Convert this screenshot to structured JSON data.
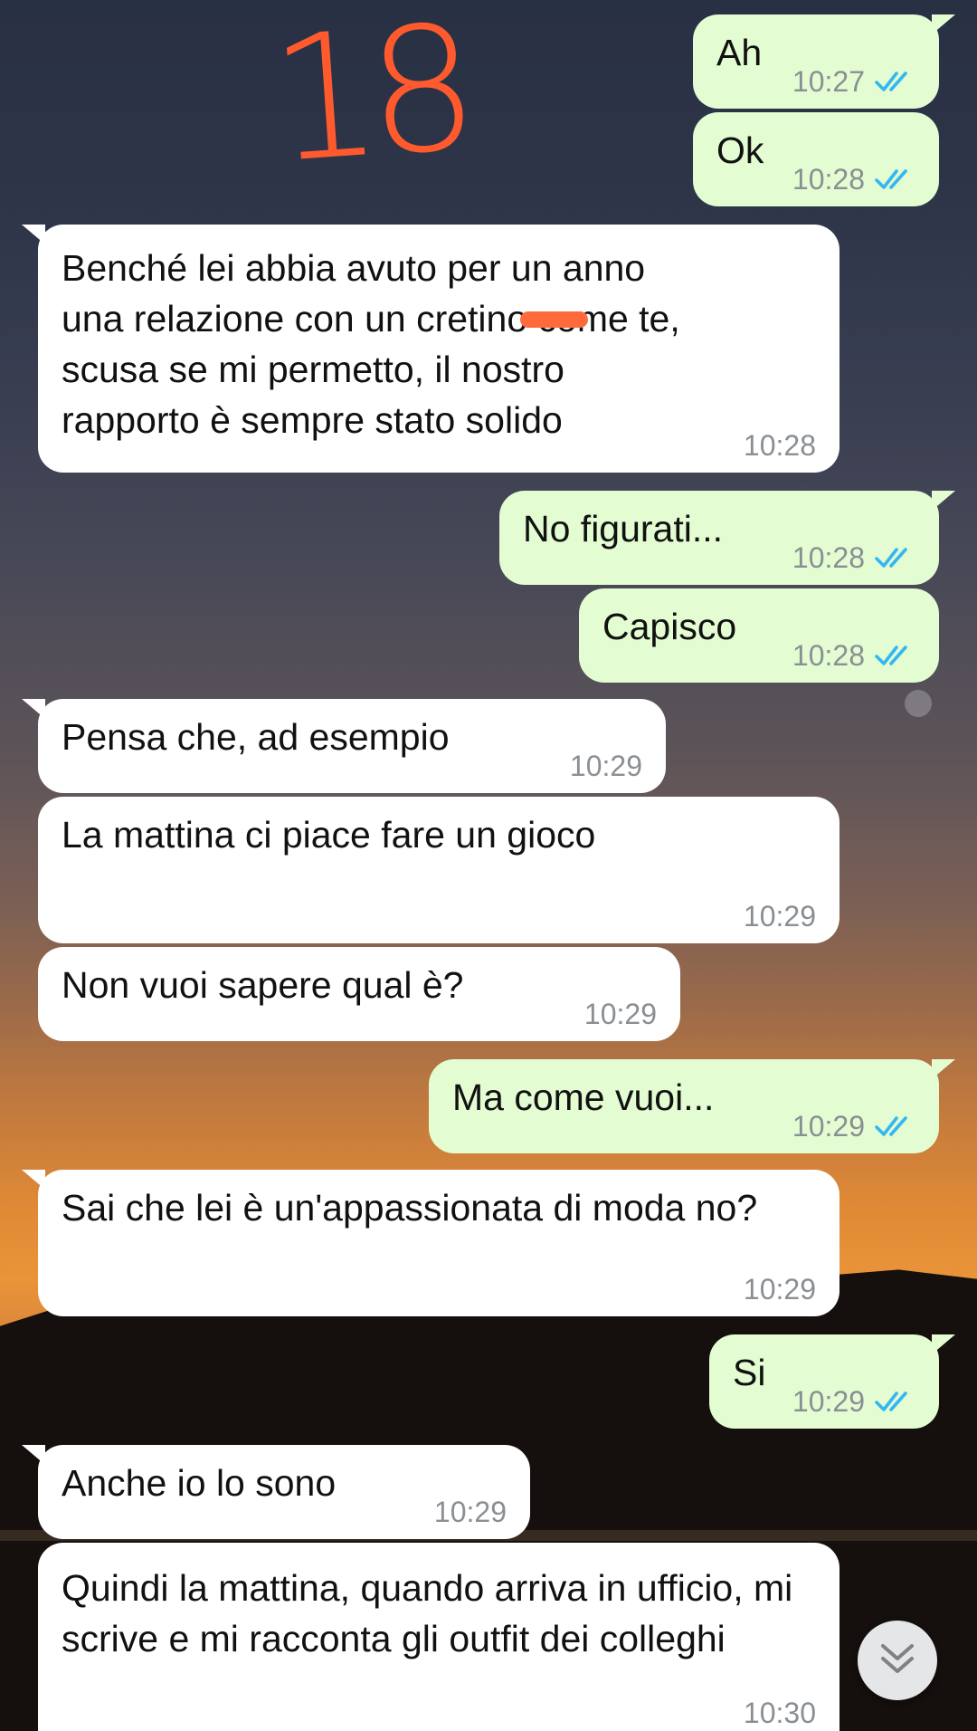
{
  "watermark": "18",
  "messages": [
    {
      "dir": "out",
      "text": "Ah",
      "time": "10:27",
      "read": true
    },
    {
      "dir": "out",
      "text": "Ok",
      "time": "10:28",
      "read": true
    },
    {
      "dir": "in",
      "text": "Benché lei abbia avuto per un anno una relazione con un cretino come te, scusa se mi permetto, il nostro rapporto è sempre stato solido",
      "time": "10:28"
    },
    {
      "dir": "out",
      "text": "No figurati...",
      "time": "10:28",
      "read": true
    },
    {
      "dir": "out",
      "text": "Capisco",
      "time": "10:28",
      "read": true
    },
    {
      "dir": "in",
      "text": "Pensa che, ad esempio",
      "time": "10:29"
    },
    {
      "dir": "in",
      "text": "La mattina ci piace fare un gioco",
      "time": "10:29"
    },
    {
      "dir": "in",
      "text": "Non vuoi sapere qual è?",
      "time": "10:29"
    },
    {
      "dir": "out",
      "text": "Ma come vuoi...",
      "time": "10:29",
      "read": true
    },
    {
      "dir": "in",
      "text": "Sai che lei è un'appassionata di moda no?",
      "time": "10:29"
    },
    {
      "dir": "out",
      "text": "Si",
      "time": "10:29",
      "read": true
    },
    {
      "dir": "in",
      "text": "Anche io lo sono",
      "time": "10:29"
    },
    {
      "dir": "in",
      "text": "Quindi la mattina, quando arriva in ufficio, mi scrive e mi racconta gli outfit dei colleghi",
      "time": "10:30"
    }
  ],
  "icons": {
    "read_receipt": "double-check-icon",
    "scroll_down": "double-chevron-down-icon"
  },
  "colors": {
    "incoming_bubble": "#ffffff",
    "outgoing_bubble": "#e3fcd2",
    "read_tick": "#34b7f1",
    "timestamp": "#8a8f94",
    "watermark": "#ff5a2e"
  }
}
